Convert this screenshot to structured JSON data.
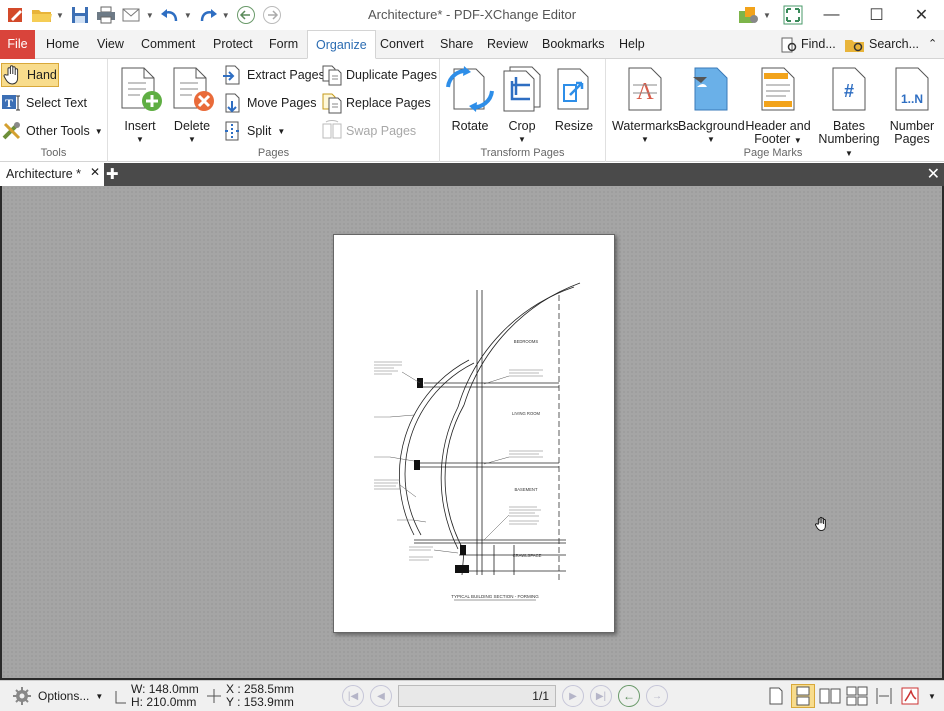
{
  "window": {
    "title": "Architecture* - PDF-XChange Editor"
  },
  "menu": {
    "file": "File",
    "items": [
      "Home",
      "View",
      "Comment",
      "Protect",
      "Form",
      "Organize",
      "Convert",
      "Share",
      "Review",
      "Bookmarks",
      "Help"
    ],
    "active": "Organize",
    "find": "Find...",
    "search": "Search..."
  },
  "ribbon": {
    "tools": {
      "label": "Tools",
      "hand": "Hand",
      "select_text": "Select Text",
      "other_tools": "Other Tools"
    },
    "pages": {
      "label": "Pages",
      "insert": "Insert",
      "delete": "Delete",
      "extract": "Extract Pages",
      "move": "Move Pages",
      "split": "Split",
      "duplicate": "Duplicate Pages",
      "replace": "Replace Pages",
      "swap": "Swap Pages"
    },
    "transform": {
      "label": "Transform Pages",
      "rotate": "Rotate",
      "crop": "Crop",
      "resize": "Resize"
    },
    "marks": {
      "label": "Page Marks",
      "watermarks": "Watermarks",
      "background": "Background",
      "header1": "Header and",
      "header2": "Footer",
      "bates1": "Bates",
      "bates2": "Numbering",
      "number1": "Number",
      "number2": "Pages",
      "number_icon": "1..N"
    }
  },
  "tab": {
    "name": "Architecture *"
  },
  "drawing": {
    "labels": [
      "BEDROOMS",
      "LIVING ROOM",
      "BASEMENT",
      "CRAWLSPACE"
    ],
    "caption": "TYPICAL BUILDING SECTION - FORMING"
  },
  "status": {
    "options": "Options...",
    "w": "W: 148.0mm",
    "h": "H: 210.0mm",
    "x": "X : 258.5mm",
    "y": "Y : 153.9mm",
    "page": "1",
    "page_total": "1"
  }
}
